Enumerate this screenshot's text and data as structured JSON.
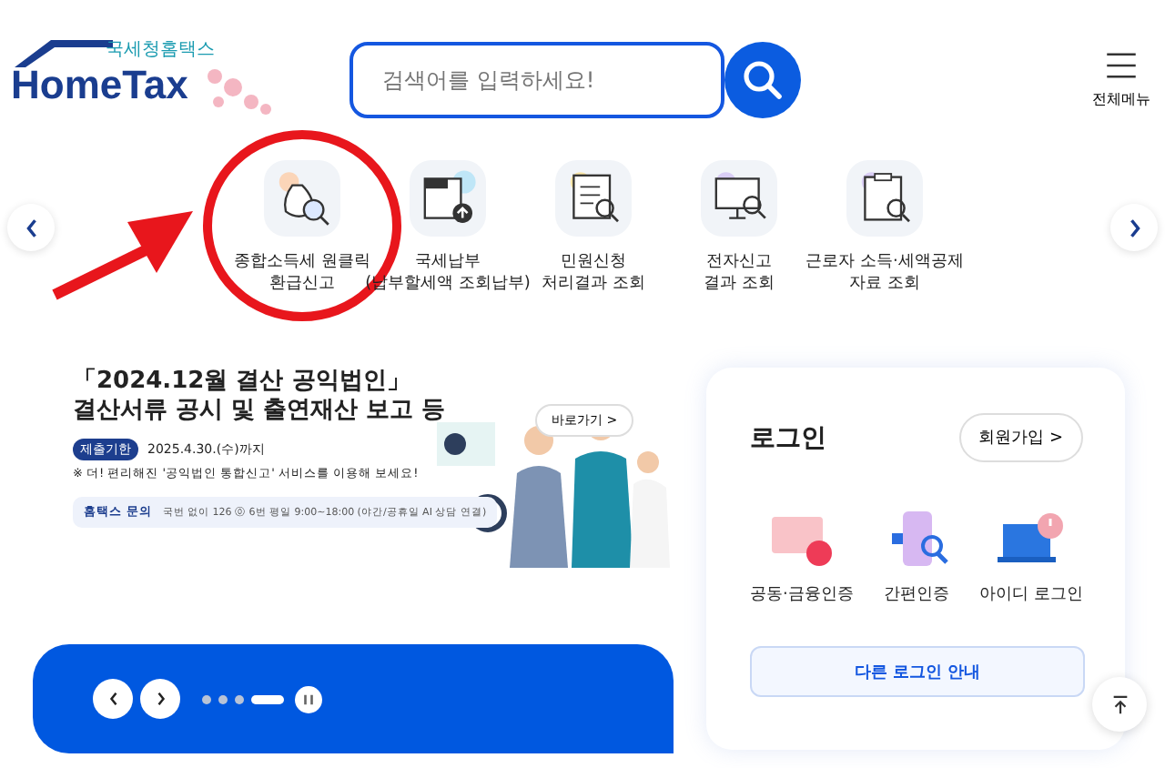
{
  "header": {
    "logo": {
      "subtitle": "국세청홈택스",
      "title": "HomeTax"
    },
    "search": {
      "placeholder": "검색어를 입력하세요!"
    },
    "menu_label": "전체메뉴"
  },
  "quick_menu": [
    {
      "lines": [
        "종합소득세 원클릭",
        "환급신고"
      ],
      "kind": "refund",
      "annotated": true
    },
    {
      "lines": [
        "국세납부",
        "(납부할세액 조회납부)"
      ],
      "kind": "pay",
      "annotated": false
    },
    {
      "lines": [
        "민원신청",
        "처리결과 조회"
      ],
      "kind": "doc",
      "annotated": false
    },
    {
      "lines": [
        "전자신고",
        "결과 조회"
      ],
      "kind": "monitor",
      "annotated": false
    },
    {
      "lines": [
        "근로자 소득·세액공제",
        "자료 조회"
      ],
      "kind": "clipboard",
      "annotated": false
    }
  ],
  "banner": {
    "title_lines": [
      "「2024.12월 결산 공익법인」",
      "결산서류 공시 및 출연재산 보고 등"
    ],
    "link": "바로가기 >",
    "badge": "제출기한",
    "deadline": "2025.4.30.(수)까지",
    "note": "※ 더! 편리해진 '공익법인 통합신고' 서비스를 이용해 보세요!",
    "contact_label": "홈택스 문의",
    "contact_text": "국번 없이 126 ⓪ 6번 평일 9:00~18:00 (야간/공휴일 AI 상담 연결)"
  },
  "carousel": {
    "dots": [
      {
        "selected": false
      },
      {
        "selected": false
      },
      {
        "selected": false
      },
      {
        "selected": true
      }
    ]
  },
  "login": {
    "title": "로그인",
    "signup": "회원가입 >",
    "methods": [
      {
        "label": "공동·금융인증",
        "kind": "cert"
      },
      {
        "label": "간편인증",
        "kind": "simple"
      },
      {
        "label": "아이디 로그인",
        "kind": "id"
      }
    ],
    "other": "다른 로그인 안내"
  }
}
